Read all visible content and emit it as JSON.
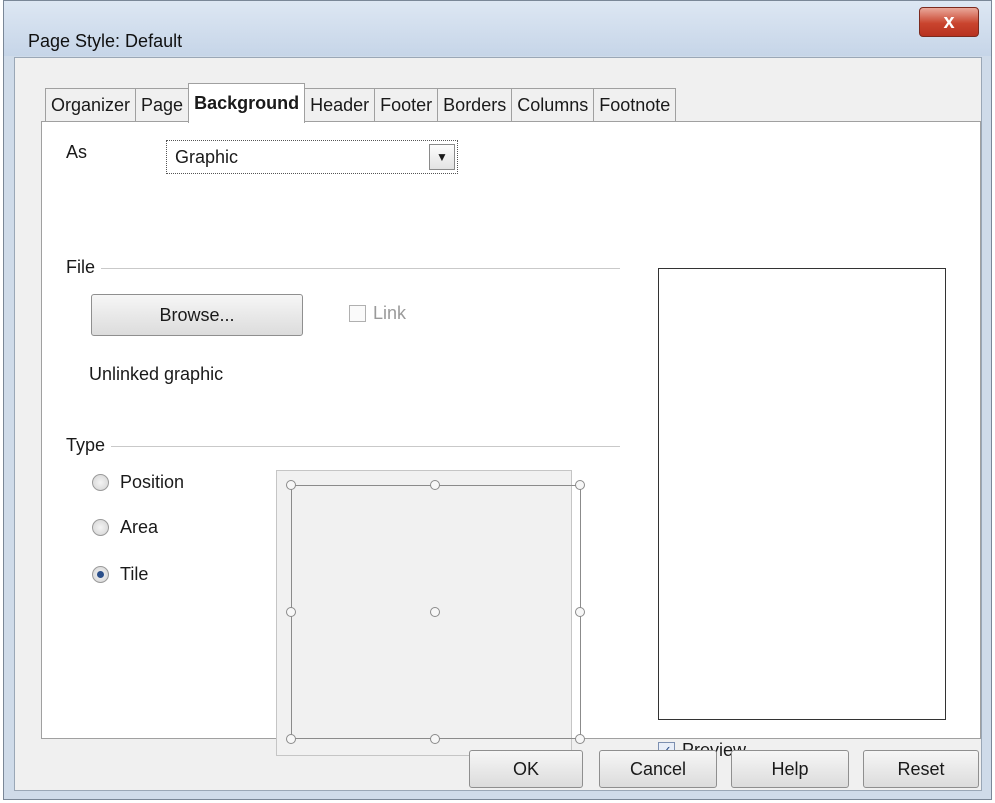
{
  "window": {
    "title": "Page Style: Default",
    "close_label": "x"
  },
  "tabs": [
    {
      "label": "Organizer"
    },
    {
      "label": "Page"
    },
    {
      "label": "Background",
      "active": true
    },
    {
      "label": "Header"
    },
    {
      "label": "Footer"
    },
    {
      "label": "Borders"
    },
    {
      "label": "Columns"
    },
    {
      "label": "Footnote"
    }
  ],
  "background": {
    "as_label": "As",
    "as_value": "Graphic",
    "file_group": "File",
    "browse_label": "Browse...",
    "link_label": "Link",
    "link_checked": false,
    "link_enabled": false,
    "status_text": "Unlinked graphic",
    "type_group": "Type",
    "type_options": [
      {
        "label": "Position",
        "selected": false
      },
      {
        "label": "Area",
        "selected": false
      },
      {
        "label": "Tile",
        "selected": true
      }
    ],
    "preview_label": "Preview",
    "preview_checked": true
  },
  "buttons": {
    "ok": "OK",
    "cancel": "Cancel",
    "help": "Help",
    "reset": "Reset"
  },
  "colors": {
    "title_bar": "#c6d5e8",
    "close_button": "#c9442e",
    "dialog_bg": "#f0f0f0",
    "panel_bg": "#ffffff"
  }
}
